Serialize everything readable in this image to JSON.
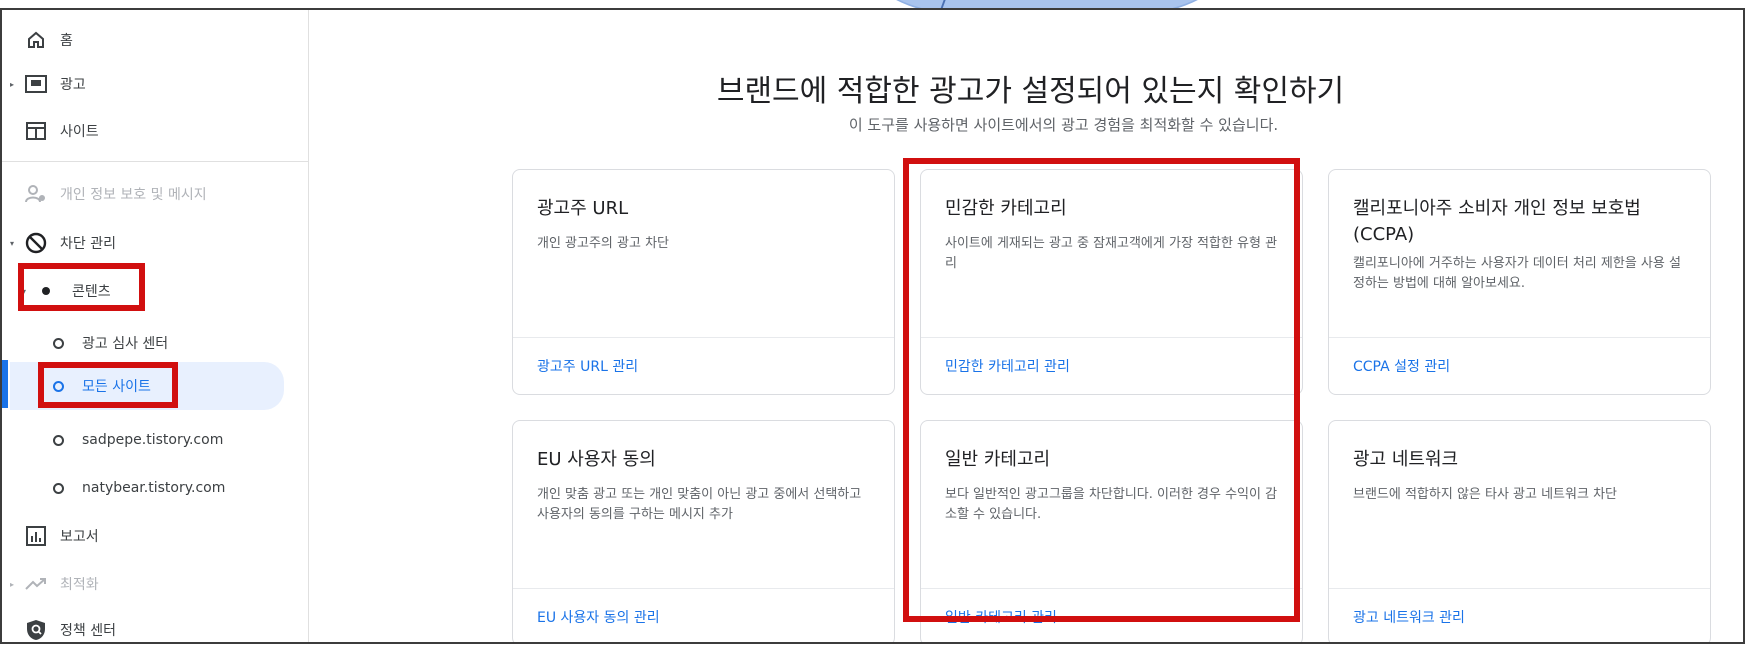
{
  "sidebar": {
    "items": [
      {
        "label": "홈",
        "icon": "home-icon"
      },
      {
        "label": "광고",
        "icon": "ads-icon"
      },
      {
        "label": "사이트",
        "icon": "sites-icon"
      },
      {
        "label": "개인 정보 보호 및 메시지",
        "icon": "privacy-icon"
      },
      {
        "label": "차단 관리",
        "icon": "block-icon"
      },
      {
        "label": "콘텐츠",
        "icon": "bullet-icon"
      },
      {
        "label": "보고서",
        "icon": "reports-icon"
      },
      {
        "label": "최적화",
        "icon": "optimization-icon"
      },
      {
        "label": "정책 센터",
        "icon": "policy-icon"
      }
    ],
    "subitems": [
      {
        "label": "광고 심사 센터"
      },
      {
        "label": "모든 사이트"
      },
      {
        "label": "sadpepe.tistory.com"
      },
      {
        "label": "natybear.tistory.com"
      }
    ]
  },
  "main": {
    "title": "브랜드에 적합한 광고가 설정되어 있는지 확인하기",
    "subtitle": "이 도구를 사용하면 사이트에서의 광고 경험을 최적화할 수 있습니다.",
    "cards": [
      {
        "title": "광고주 URL",
        "desc": "개인 광고주의 광고 차단",
        "link": "광고주 URL 관리"
      },
      {
        "title": "민감한 카테고리",
        "desc": "사이트에 게재되는 광고 중 잠재고객에게 가장 적합한 유형 관리",
        "link": "민감한 카테고리 관리"
      },
      {
        "title": "캘리포니아주 소비자 개인 정보 보호법 (CCPA)",
        "desc": "캘리포니아에 거주하는 사용자가 데이터 처리 제한을 사용 설정하는 방법에 대해 알아보세요.",
        "link": "CCPA 설정 관리"
      },
      {
        "title": "EU 사용자 동의",
        "desc": "개인 맞춤 광고 또는 개인 맞춤이 아닌 광고 중에서 선택하고 사용자의 동의를 구하는 메시지 추가",
        "link": "EU 사용자 동의 관리"
      },
      {
        "title": "일반 카테고리",
        "desc": "보다 일반적인 광고그룹을 차단합니다. 이러한 경우 수익이 감소할 수 있습니다.",
        "link": "일반 카테고리 관리"
      },
      {
        "title": "광고 네트워크",
        "desc": "브랜드에 적합하지 않은 타사 광고 네트워크 차단",
        "link": "광고 네트워크 관리"
      }
    ]
  },
  "colors": {
    "accent": "#1a73e8",
    "highlight": "#d10f0f",
    "active_bg": "#e8f0fe"
  }
}
